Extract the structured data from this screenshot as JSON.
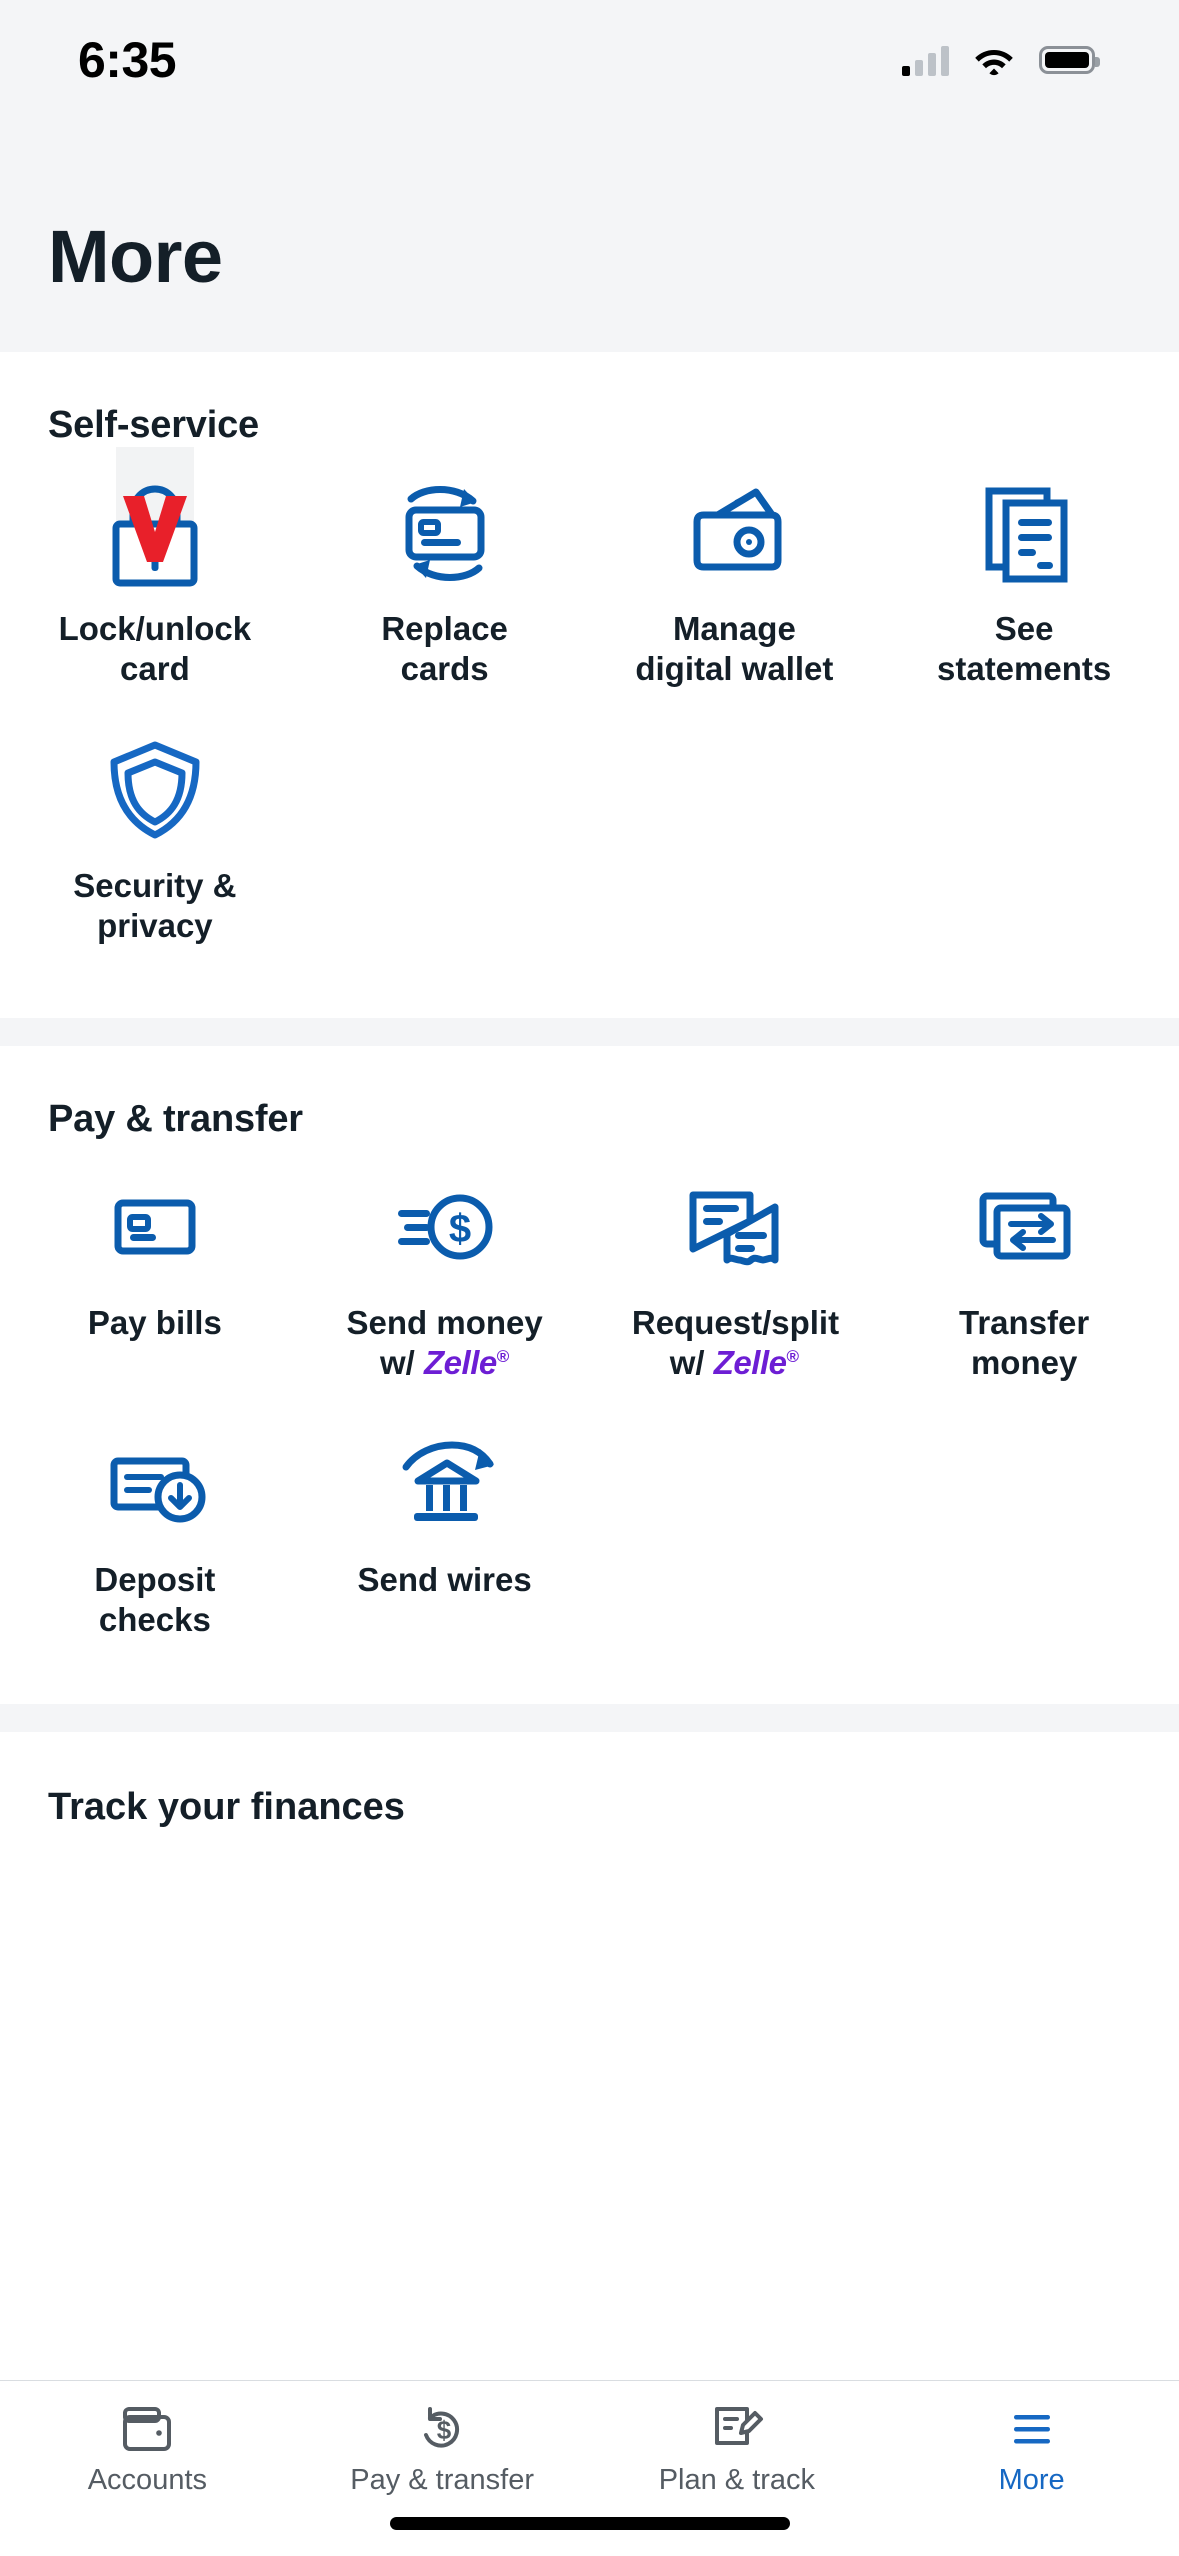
{
  "status_bar": {
    "time": "6:35",
    "cellular_icon": "signal-bars-icon",
    "wifi_icon": "wifi-icon",
    "battery_icon": "battery-icon"
  },
  "header": {
    "title": "More"
  },
  "sections": [
    {
      "id": "self-service",
      "title": "Self-service",
      "items": [
        {
          "label": "Lock/unlock card",
          "icon": "padlock-icon",
          "focused": true
        },
        {
          "label": "Replace cards",
          "icon": "card-refresh-icon",
          "focused": false
        },
        {
          "label": "Manage digital wallet",
          "icon": "wallet-cards-icon",
          "focused": false
        },
        {
          "label": "See statements",
          "icon": "documents-icon",
          "focused": false
        },
        {
          "label": "Security & privacy",
          "icon": "shield-icon",
          "focused": false
        }
      ]
    },
    {
      "id": "pay-transfer",
      "title": "Pay & transfer",
      "items": [
        {
          "label": "Pay bills",
          "icon": "card-icon",
          "focused": false
        },
        {
          "label": "Send money",
          "label2_prefix": "w/ ",
          "brand": "Zelle",
          "brand_mark": "®",
          "icon": "send-money-zelle-icon",
          "focused": false
        },
        {
          "label": "Request/split",
          "label2_prefix": "w/ ",
          "brand": "Zelle",
          "brand_mark": "®",
          "icon": "split-receipts-icon",
          "focused": false
        },
        {
          "label": "Transfer money",
          "icon": "transfer-money-icon",
          "focused": false
        },
        {
          "label": "Deposit checks",
          "icon": "deposit-check-icon",
          "focused": false
        },
        {
          "label": "Send wires",
          "icon": "send-wires-icon",
          "focused": false
        }
      ]
    }
  ],
  "track_section": {
    "title": "Track your finances"
  },
  "tabbar": {
    "tabs": [
      {
        "label": "Accounts",
        "icon": "wallet-icon",
        "active": false
      },
      {
        "label": "Pay & transfer",
        "icon": "dollar-refresh-icon",
        "active": false
      },
      {
        "label": "Plan & track",
        "icon": "note-pencil-icon",
        "active": false
      },
      {
        "label": "More",
        "icon": "hamburger-icon",
        "active": true
      }
    ]
  },
  "colors": {
    "brand_blue": "#0b5cad",
    "active_blue": "#1668c3",
    "zelle_purple": "#6d1ed4",
    "cursor_red": "#e8202a",
    "text_dark": "#141f28",
    "bg_gray": "#f4f5f7"
  }
}
